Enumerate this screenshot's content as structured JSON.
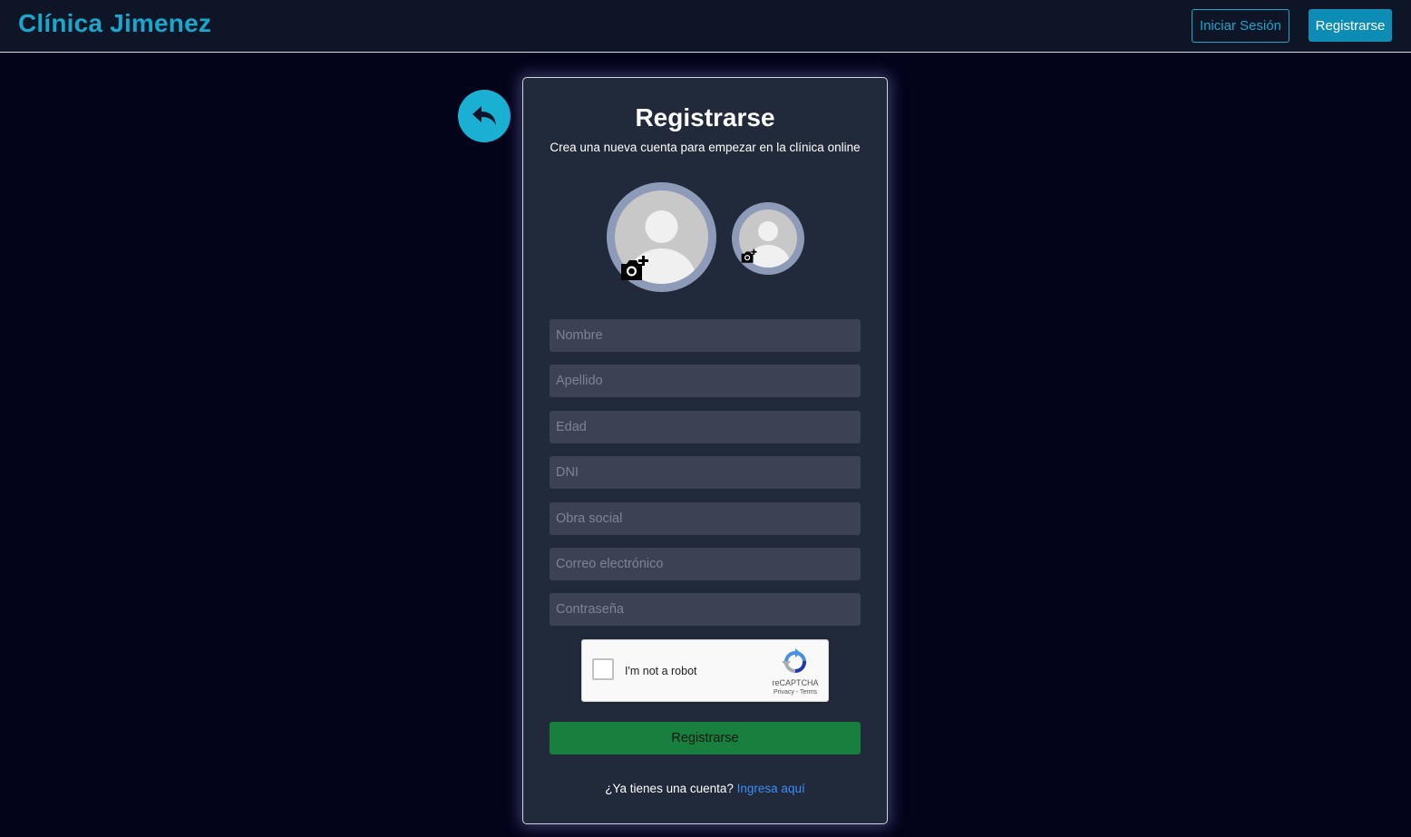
{
  "header": {
    "brand": "Clínica Jimenez",
    "login_label": "Iniciar Sesión",
    "register_label": "Registrarse"
  },
  "back_button": {
    "icon": "reply-arrow-icon"
  },
  "form": {
    "title": "Registrarse",
    "subtitle": "Crea una nueva cuenta para empezar en la clínica online",
    "avatars": [
      {
        "icon": "camera-plus-icon"
      },
      {
        "icon": "camera-plus-icon"
      }
    ],
    "fields": {
      "nombre": {
        "placeholder": "Nombre",
        "value": ""
      },
      "apellido": {
        "placeholder": "Apellido",
        "value": ""
      },
      "edad": {
        "placeholder": "Edad",
        "value": ""
      },
      "dni": {
        "placeholder": "DNI",
        "value": ""
      },
      "obra_social": {
        "placeholder": "Obra social",
        "value": ""
      },
      "email": {
        "placeholder": "Correo electrónico",
        "value": ""
      },
      "password": {
        "placeholder": "Contraseña",
        "value": ""
      }
    },
    "captcha": {
      "label": "I'm not a robot",
      "brand": "reCAPTCHA",
      "links": "Privacy - Terms"
    },
    "submit_label": "Registrarse",
    "footer_text": "¿Ya tienes una cuenta?",
    "footer_link": "Ingresa aquí"
  },
  "colors": {
    "page_bg": "#03031a",
    "navbar_bg": "#0d1526",
    "accent": "#19a7cc",
    "card_bg": "#212a3a",
    "submit_bg": "#187f3f",
    "link": "#3b8cf5"
  }
}
